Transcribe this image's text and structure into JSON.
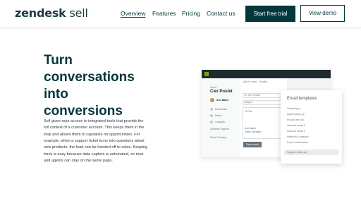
{
  "header": {
    "logo_main": "zendesk",
    "logo_suffix": " sell",
    "nav": [
      "Overview",
      "Features",
      "Pricing",
      "Contact us"
    ],
    "cta_primary": "Start free trial",
    "cta_secondary": "View demo"
  },
  "hero": {
    "headline_lines": [
      "Turn",
      "conversations",
      "into",
      "conversions"
    ],
    "body": "Sell gives reps access to integrated tools that provide the full context of a customer account. This keeps them in the loop and allows them to capitalize on opportunities. For example, when a support ticket turns into questions about new products, the lead can be handed off to sales. Keeping track is easy because data capture is automated, so reps and agents can stay on the same page."
  },
  "mock": {
    "client_label": "Client",
    "client_name": "Cier Poulet",
    "user_name": "Ann Baker",
    "side_items": [
      "Dashboard",
      "Deals",
      "Contacts",
      "Zendesk Support",
      "Deals Tracking"
    ],
    "center_header": [
      "Add to Lead",
      "Details"
    ],
    "fields": [
      "To: Cier Poulet",
      "Subject",
      "Hi Cier,",
      "Ann Baker",
      "Sales Manager"
    ],
    "send_label": "Send email"
  },
  "templates": {
    "title": "Email templates",
    "items": [
      "Checking in",
      "Quick follow-up",
      "Hi how are you",
      "Inbound email 1",
      "Inbound email 2",
      "Initial visit outreach",
      "Lunch confirmation",
      "Support follow-up"
    ],
    "selected_index": 7
  },
  "colors": {
    "brand_dark": "#03363d",
    "white": "#ffffff",
    "text_gray": "#2f3941",
    "selected_bg": "#e9ebed"
  }
}
